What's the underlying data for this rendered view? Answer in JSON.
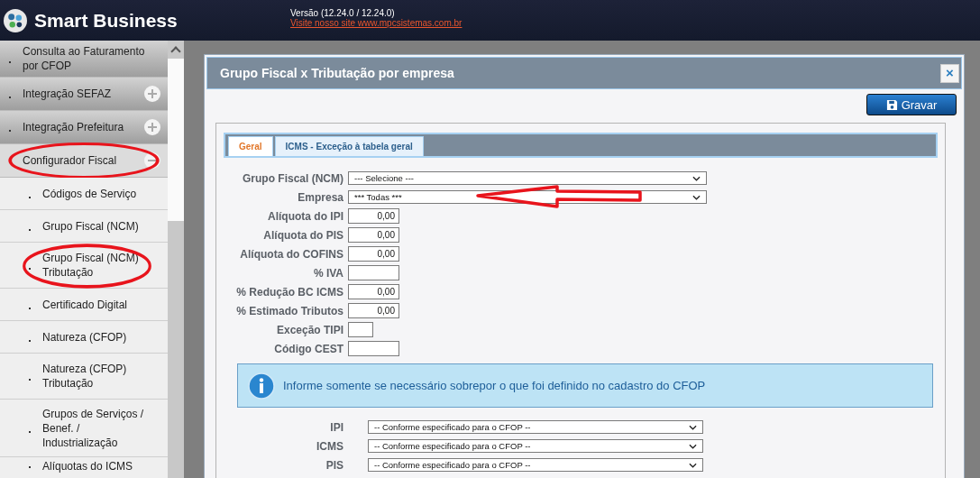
{
  "header": {
    "app_name": "Smart Business",
    "version": "Versão (12.24.0 / 12.24.0)",
    "site_link": "Visite nosso site www.mpcsistemas.com.br"
  },
  "sidebar": {
    "items": [
      {
        "label": "Consulta ao Faturamento por CFOP",
        "kind": "group",
        "expanded": false,
        "toggle": false,
        "highlighted": false
      },
      {
        "label": "Integração SEFAZ",
        "kind": "group",
        "expanded": false,
        "toggle": true,
        "highlighted": false
      },
      {
        "label": "Integração Prefeitura",
        "kind": "group",
        "expanded": false,
        "toggle": true,
        "highlighted": false
      },
      {
        "label": "Configurador Fiscal",
        "kind": "group",
        "expanded": true,
        "toggle": true,
        "highlighted": true
      },
      {
        "label": "Códigos de Serviço",
        "kind": "child",
        "highlighted": false
      },
      {
        "label": "Grupo Fiscal (NCM)",
        "kind": "child",
        "highlighted": false
      },
      {
        "label": "Grupo Fiscal (NCM) Tributação",
        "kind": "child",
        "highlighted": true
      },
      {
        "label": "Certificado Digital",
        "kind": "child",
        "highlighted": false
      },
      {
        "label": "Natureza (CFOP)",
        "kind": "child",
        "highlighted": false
      },
      {
        "label": "Natureza (CFOP) Tributação",
        "kind": "child",
        "highlighted": false
      },
      {
        "label": "Grupos de Serviços / Benef. / Industrialização",
        "kind": "child",
        "highlighted": false
      },
      {
        "label": "Alíquotas do ICMS",
        "kind": "child",
        "highlighted": false
      }
    ]
  },
  "dialog": {
    "title": "Grupo Fiscal x Tributação por empresa",
    "close": "×",
    "save_button": "Gravar",
    "tabs": [
      {
        "label": "Geral",
        "selected": true
      },
      {
        "label": "ICMS - Exceção à tabela geral",
        "selected": false
      }
    ],
    "fields": [
      {
        "label": "Grupo Fiscal (NCM)",
        "kind": "select",
        "value": "--- Selecione ---",
        "annotated": false
      },
      {
        "label": "Empresa",
        "kind": "select",
        "value": "*** Todas ***",
        "annotated": true
      },
      {
        "label": "Alíquota do IPI",
        "kind": "number",
        "value": "0,00"
      },
      {
        "label": "Alíquota do PIS",
        "kind": "number",
        "value": "0,00"
      },
      {
        "label": "Alíquota do COFINS",
        "kind": "number",
        "value": "0,00"
      },
      {
        "label": "% IVA",
        "kind": "number"
      },
      {
        "label": "% Redução BC ICMS",
        "kind": "number",
        "value": "0,00"
      },
      {
        "label": "% Estimado Tributos",
        "kind": "number",
        "value": "0,00"
      },
      {
        "label": "Exceção TIPI",
        "kind": "short"
      },
      {
        "label": "Código CEST",
        "kind": "number"
      }
    ],
    "info": "Informe somente se necessário sobrepor o que foi definido no cadastro do CFOP",
    "tax_fields": [
      {
        "label": "IPI",
        "value": "-- Conforme especificado para o CFOP --"
      },
      {
        "label": "ICMS",
        "value": "-- Conforme especificado para o CFOP --"
      },
      {
        "label": "PIS",
        "value": "-- Conforme especificado para o CFOP --"
      }
    ]
  }
}
